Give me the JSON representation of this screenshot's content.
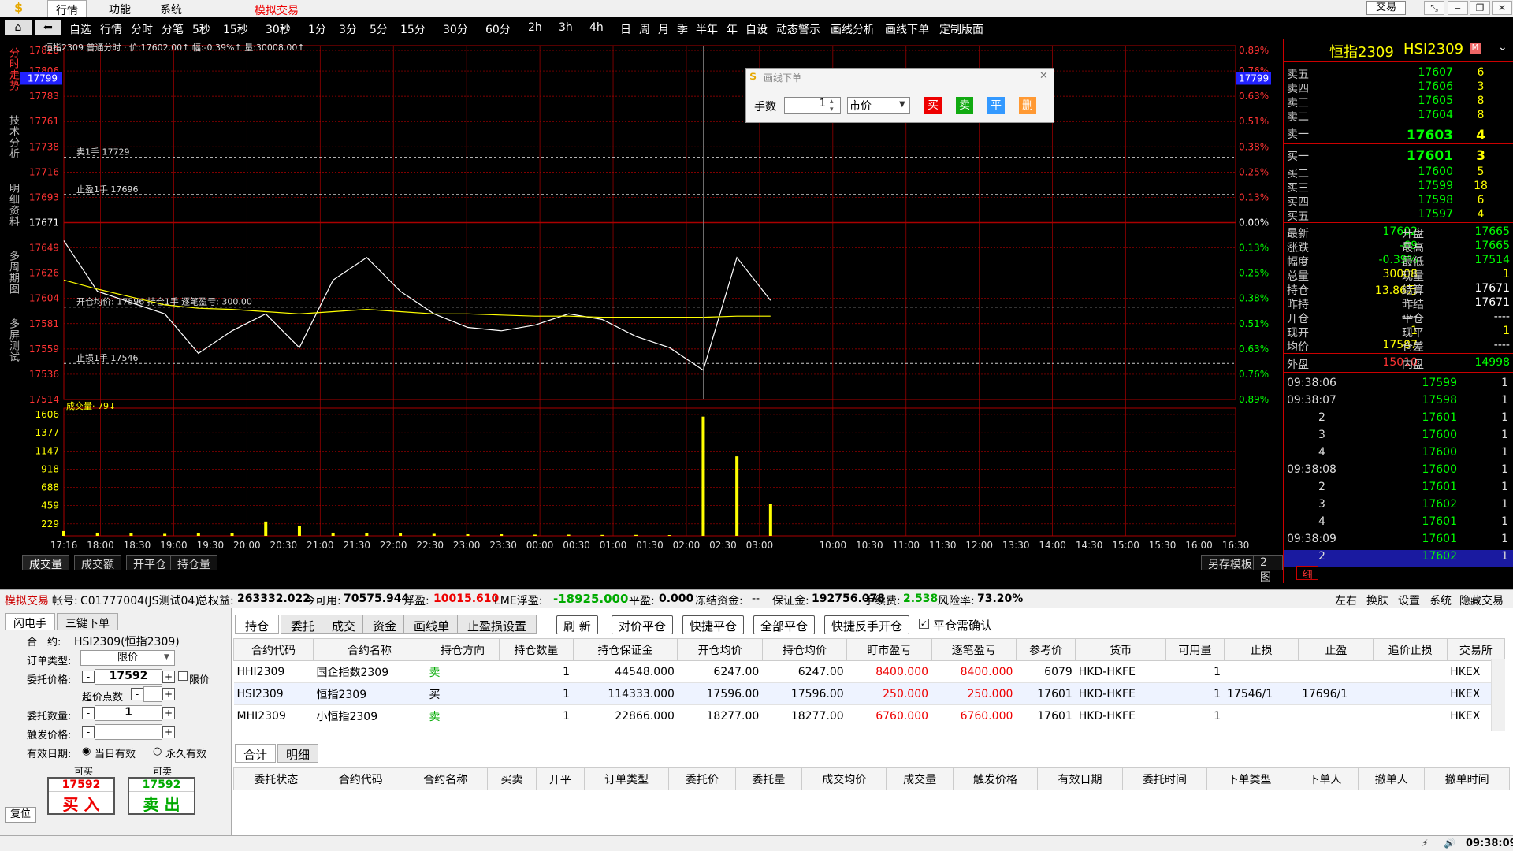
{
  "menu": {
    "logo": "$",
    "tabs": [
      "行情",
      "功能",
      "系统"
    ],
    "mode": "模拟交易",
    "trade_button": "交易"
  },
  "toolbar": {
    "items": [
      "自选",
      "行情",
      "分时",
      "分笔",
      "5秒",
      "15秒",
      "30秒",
      "1分",
      "3分",
      "5分",
      "15分",
      "30分",
      "60分",
      "2h",
      "3h",
      "4h",
      "日",
      "周",
      "月",
      "季",
      "半年",
      "年",
      "自设",
      "动态警示",
      "画线分析",
      "画线下单",
      "定制版面"
    ]
  },
  "left_tabs": [
    "分时走势",
    "技术分析",
    "明细资料",
    "多周期图",
    "多屏测试"
  ],
  "chart": {
    "header": "恒指2309 普通分时 · 价:17602.00↑ 幅:-0.39%↑ 量:30008.00↑",
    "volume_header": "成交量· 79↓",
    "current_price_badge": "17799",
    "price_ticks": [
      "17828",
      "17806",
      "17783",
      "17761",
      "17738",
      "17716",
      "17693",
      "17671",
      "17649",
      "17626",
      "17604",
      "17581",
      "17559",
      "17536",
      "17514"
    ],
    "pct_ticks": [
      "0.89%",
      "0.76%",
      "0.63%",
      "0.51%",
      "0.38%",
      "0.25%",
      "0.13%",
      "0.00%",
      "0.13%",
      "0.25%",
      "0.38%",
      "0.51%",
      "0.63%",
      "0.76%",
      "0.89%"
    ],
    "volume_ticks": [
      "1606",
      "1377",
      "1147",
      "918",
      "688",
      "459",
      "229"
    ],
    "time_ticks": [
      "17:16",
      "18:00",
      "18:30",
      "19:00",
      "19:30",
      "20:00",
      "20:30",
      "21:00",
      "21:30",
      "22:00",
      "22:30",
      "23:00",
      "23:30",
      "00:00",
      "00:30",
      "01:00",
      "01:30",
      "02:00",
      "02:30",
      "03:00",
      "",
      "10:00",
      "10:30",
      "11:00",
      "11:30",
      "12:00",
      "13:30",
      "14:00",
      "14:30",
      "15:00",
      "15:30",
      "16:00",
      "16:30"
    ],
    "lines": [
      {
        "label": "卖1手 17729",
        "price": 17729
      },
      {
        "label": "止盈1手 17696",
        "price": 17696
      },
      {
        "label": "开仓均价: 17596  持仓1手  逐笔盈亏: 300.00",
        "price": 17596
      },
      {
        "label": "止损1手 17546",
        "price": 17546
      }
    ]
  },
  "chart_data": {
    "type": "line",
    "title": "恒指2309",
    "ylim": [
      17514,
      17828
    ],
    "x": [
      "17:16",
      "18:00",
      "19:00",
      "20:00",
      "20:30",
      "21:00",
      "21:30",
      "22:00",
      "22:30",
      "22:45",
      "23:00",
      "23:30",
      "00:00",
      "00:30",
      "01:00",
      "01:30",
      "02:00",
      "02:30",
      "03:00",
      "03:05",
      "03:10",
      "03:15"
    ],
    "series": [
      {
        "name": "价",
        "values": [
          17655,
          17610,
          17600,
          17590,
          17555,
          17575,
          17590,
          17560,
          17620,
          17640,
          17610,
          17590,
          17578,
          17575,
          17580,
          17590,
          17585,
          17570,
          17560,
          17540,
          17640,
          17602
        ]
      },
      {
        "name": "均价",
        "values": [
          17620,
          17612,
          17605,
          17598,
          17595,
          17594,
          17592,
          17590,
          17592,
          17594,
          17592,
          17590,
          17590,
          17589,
          17588,
          17588,
          17587,
          17587,
          17587,
          17587,
          17588,
          17588
        ]
      }
    ],
    "volume": {
      "ylim": [
        0,
        1606
      ],
      "values": [
        60,
        40,
        30,
        25,
        35,
        30,
        180,
        120,
        40,
        30,
        35,
        25,
        20,
        20,
        15,
        15,
        12,
        12,
        10,
        1500,
        1000,
        400
      ]
    }
  },
  "subtabs": [
    "成交量",
    "成交额",
    "开平仓",
    "持仓量"
  ],
  "subtabs_right": [
    "另存模板",
    "2图"
  ],
  "dialog": {
    "title": "画线下单",
    "qty_label": "手数",
    "qty": "1",
    "order_type": "市价",
    "buttons": [
      "买",
      "卖",
      "平",
      "删"
    ]
  },
  "sidebar": {
    "title": "恒指2309",
    "code": "HSI2309",
    "asks": [
      {
        "l": "卖五",
        "p": "17607",
        "v": "6"
      },
      {
        "l": "卖四",
        "p": "17606",
        "v": "3"
      },
      {
        "l": "卖三",
        "p": "17605",
        "v": "8"
      },
      {
        "l": "卖二",
        "p": "17604",
        "v": "8"
      },
      {
        "l": "卖一",
        "p": "17603",
        "v": "4"
      }
    ],
    "bids": [
      {
        "l": "买一",
        "p": "17601",
        "v": "3"
      },
      {
        "l": "买二",
        "p": "17600",
        "v": "5"
      },
      {
        "l": "买三",
        "p": "17599",
        "v": "18"
      },
      {
        "l": "买四",
        "p": "17598",
        "v": "6"
      },
      {
        "l": "买五",
        "p": "17597",
        "v": "4"
      }
    ],
    "stats": [
      [
        "最新",
        "17602",
        "开盘",
        "17665"
      ],
      [
        "涨跌",
        "-69",
        "最高",
        "17665"
      ],
      [
        "幅度",
        "-0.39%",
        "最低",
        "17514"
      ],
      [
        "总量",
        "30008",
        "现量",
        "1"
      ],
      [
        "持仓",
        "13.86万",
        "结算",
        "17671"
      ],
      [
        "昨持",
        "----",
        "昨结",
        "17671"
      ],
      [
        "开仓",
        "----",
        "平仓",
        "----"
      ],
      [
        "现开",
        "1",
        "现平",
        "1"
      ],
      [
        "均价",
        "17587",
        "仓差",
        "----"
      ]
    ],
    "outer": {
      "l": "外盘",
      "v": "15010",
      "l2": "内盘",
      "v2": "14998"
    },
    "ticks": [
      {
        "t": "09:38:06",
        "p": "17599",
        "v": "1"
      },
      {
        "t": "09:38:07",
        "p": "17598",
        "v": "1"
      },
      {
        "t": "2",
        "p": "17601",
        "v": "1"
      },
      {
        "t": "3",
        "p": "17600",
        "v": "1"
      },
      {
        "t": "4",
        "p": "17600",
        "v": "1"
      },
      {
        "t": "09:38:08",
        "p": "17600",
        "v": "1"
      },
      {
        "t": "2",
        "p": "17601",
        "v": "1"
      },
      {
        "t": "3",
        "p": "17602",
        "v": "1"
      },
      {
        "t": "4",
        "p": "17601",
        "v": "1"
      },
      {
        "t": "09:38:09",
        "p": "17601",
        "v": "1"
      },
      {
        "t": "2",
        "p": "17602",
        "v": "1"
      }
    ],
    "detail_tab": "细"
  },
  "status": {
    "mode": "模拟交易",
    "account_label": "帐号:",
    "account": "C01777004(JS测试04)",
    "equity_label": "总权益:",
    "equity": "263332.022",
    "available_label": "今可用:",
    "available": "70575.944",
    "float_label": "浮盈:",
    "float": "10015.610",
    "lme_label": "LME浮盈:",
    "lme": "-18925.000",
    "close_label": "平盈:",
    "close": "0.000",
    "frozen_label": "冻结资金:",
    "frozen": "--",
    "margin_label": "保证金:",
    "margin": "192756.078",
    "fee_label": "手续费:",
    "fee": "2.538",
    "risk_label": "风险率:",
    "risk": "73.20%",
    "right": [
      "左右",
      "换肤",
      "设置",
      "系统",
      "隐藏交易"
    ]
  },
  "form": {
    "tabs": [
      "闪电手",
      "三键下单"
    ],
    "contract_label": "合　约:",
    "contract": "HSI2309(恒指2309)",
    "ordertype_label": "订单类型:",
    "ordertype": "限价",
    "price_label": "委托价格:",
    "price": "17592",
    "limit_label": "限价",
    "over_label": "超价点数",
    "qty_label": "委托数量:",
    "qty": "1",
    "trigger_label": "触发价格:",
    "valid_label": "有效日期:",
    "valid1": "当日有效",
    "valid2": "永久有效",
    "can_buy": "可买",
    "can_sell": "可卖",
    "buy_price": "17592",
    "buy_label": "买 入",
    "sell_price": "17592",
    "sell_label": "卖 出",
    "reset": "复位"
  },
  "positions": {
    "tabs": [
      "持仓",
      "委托",
      "成交",
      "资金",
      "画线单",
      "止盈损设置"
    ],
    "actions": [
      "刷 新",
      "对价平仓",
      "快捷平仓",
      "全部平仓",
      "快捷反手开仓"
    ],
    "confirm_label": "平仓需确认",
    "headers": [
      "合约代码",
      "合约名称",
      "持仓方向",
      "持仓数量",
      "持仓保证金",
      "开仓均价",
      "持仓均价",
      "盯市盈亏",
      "逐笔盈亏",
      "参考价",
      "货币",
      "可用量",
      "止损",
      "止盈",
      "追价止损",
      "交易所"
    ],
    "rows": [
      [
        "HHI2309",
        "国企指数2309",
        "卖",
        "1",
        "44548.000",
        "6247.00",
        "6247.00",
        "8400.000",
        "8400.000",
        "6079",
        "HKD-HKFE",
        "1",
        "",
        "",
        "",
        "HKEX"
      ],
      [
        "HSI2309",
        "恒指2309",
        "买",
        "1",
        "114333.000",
        "17596.00",
        "17596.00",
        "250.000",
        "250.000",
        "17601",
        "HKD-HKFE",
        "1",
        "17546/1",
        "17696/1",
        "",
        "HKEX"
      ],
      [
        "MHI2309",
        "小恒指2309",
        "卖",
        "1",
        "22866.000",
        "18277.00",
        "18277.00",
        "6760.000",
        "6760.000",
        "17601",
        "HKD-HKFE",
        "1",
        "",
        "",
        "",
        "HKEX"
      ]
    ]
  },
  "orders": {
    "tabs": [
      "合计",
      "明细"
    ],
    "headers": [
      "委托状态",
      "合约代码",
      "合约名称",
      "买卖",
      "开平",
      "订单类型",
      "委托价",
      "委托量",
      "成交均价",
      "成交量",
      "触发价格",
      "有效日期",
      "委托时间",
      "下单类型",
      "下单人",
      "撤单人",
      "撤单时间"
    ]
  },
  "footer": {
    "time": "09:38:09"
  }
}
